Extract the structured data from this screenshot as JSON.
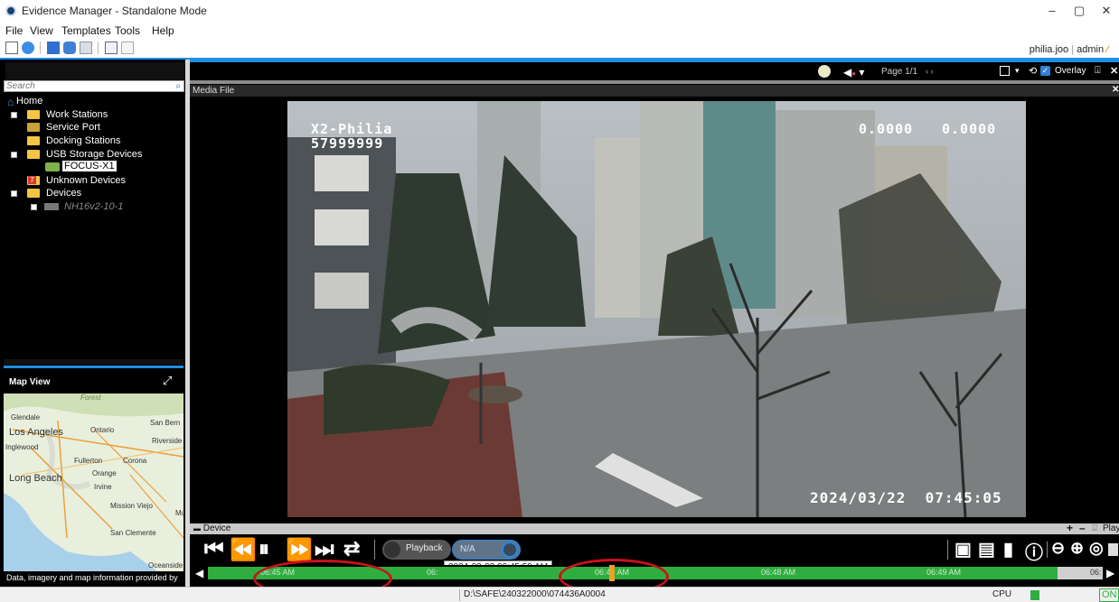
{
  "window": {
    "title": "Evidence Manager - Standalone Mode",
    "minimize": "–",
    "restore": "▢",
    "close": "✕"
  },
  "menu": [
    "File",
    "View",
    "Templates",
    "Tools",
    "Help"
  ],
  "user": {
    "name": "philia.joo",
    "role": "admin"
  },
  "tree": {
    "search_placeholder": "Search",
    "items": [
      {
        "label": "Home"
      },
      {
        "label": "Work Stations"
      },
      {
        "label": "Service Port"
      },
      {
        "label": "Docking Stations"
      },
      {
        "label": "USB Storage Devices"
      },
      {
        "label": "FOCUS-X1"
      },
      {
        "label": "Unknown Devices"
      },
      {
        "label": "Devices"
      },
      {
        "label": "NH16v2-10-1"
      }
    ],
    "unknown_count": "7"
  },
  "map": {
    "title": "Map View",
    "attribution": "Data, imagery and map information provided by",
    "labels": [
      "Forest",
      "Glendale",
      "San Bern",
      "Los Angeles",
      "Ontario",
      "Riverside",
      "Inglewood",
      "Fullerton",
      "Corona",
      "Long Beach",
      "Orange",
      "Irvine",
      "Mission Viejo",
      "Mu",
      "San Clemente",
      "Oceanside"
    ]
  },
  "viewer": {
    "page": "Page 1/1",
    "overlay": "Overlay",
    "media_file_label": "Media File",
    "overlay_text": {
      "line1": "X2-Philia",
      "line2": "57999999",
      "coord1": "0.0000",
      "coord2": "0.0000",
      "timestamp": "2024/03/22  07:45:05"
    }
  },
  "device_bar": {
    "label": "Device",
    "playback": "Playback"
  },
  "controls": {
    "playback_label": "Playback",
    "toggle_value": "N/A",
    "tooltip": "2024-03-22 06:45:59 AM"
  },
  "timeline": {
    "ticks": [
      "06:45 AM",
      "06:",
      "06:47 AM",
      "06:48 AM",
      "06:49 AM",
      "06:"
    ]
  },
  "status": {
    "path": "D:\\SAFE\\240322000\\074436A0004",
    "cpu": "CPU",
    "on": "ON"
  },
  "colors": {
    "accent_blue": "#1f8ee0",
    "timeline_green": "#2fae3f",
    "annotation_red": "#c8121b"
  }
}
